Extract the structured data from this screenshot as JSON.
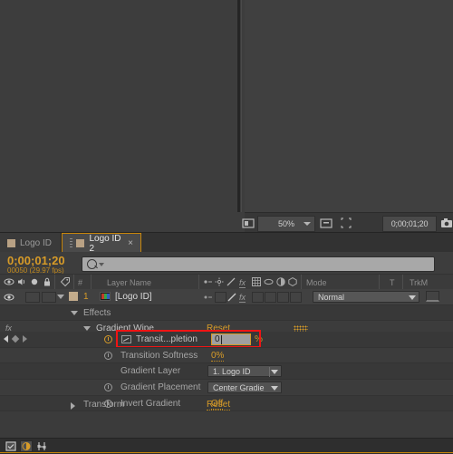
{
  "app": "Adobe After Effects",
  "viewer": {
    "zoom": "50%",
    "timecode": "0;00;01;20",
    "icons": [
      "toggle-transparency-icon",
      "zoom-dropdown",
      "region-of-interest-icon",
      "mask-toggle-icon",
      "snapshot-icon",
      "show-channel-icon",
      "color-channel-icon"
    ]
  },
  "tabs": [
    {
      "label": "Logo ID",
      "active": false,
      "closable": false
    },
    {
      "label": "Logo ID 2",
      "active": true,
      "closable": true,
      "close": "×"
    }
  ],
  "timeline": {
    "current_time": "0;00;01;20",
    "frame_info": "00050 (29.97 fps)",
    "search_placeholder": "",
    "columns": {
      "layer_name": "Layer Name",
      "index": "#",
      "mode": "Mode",
      "t": "T",
      "trkmat": "TrkM"
    },
    "layer": {
      "index": "1",
      "name": "[Logo ID]",
      "mode": "Normal"
    },
    "rows": {
      "effects": "Effects",
      "gradient_wipe": "Gradient Wipe",
      "gradient_wipe_reset": "Reset",
      "transition_completion": {
        "label": "Transit...pletion",
        "value": "0",
        "unit": "%"
      },
      "transition_softness": {
        "label": "Transition Softness",
        "value": "0%"
      },
      "gradient_layer": {
        "label": "Gradient Layer",
        "value": "1. Logo ID"
      },
      "gradient_placement": {
        "label": "Gradient Placement",
        "value": "Center Gradie"
      },
      "invert_gradient": {
        "label": "Invert Gradient",
        "value": "Off"
      },
      "transform": {
        "label": "Transform",
        "value": "Reset"
      }
    },
    "fx_badge": "fx"
  },
  "colors": {
    "accent_orange": "#d79b28",
    "highlight_red": "#f01414",
    "panel_bg": "#3b3b3b",
    "tab_active_border": "#c8860a"
  }
}
